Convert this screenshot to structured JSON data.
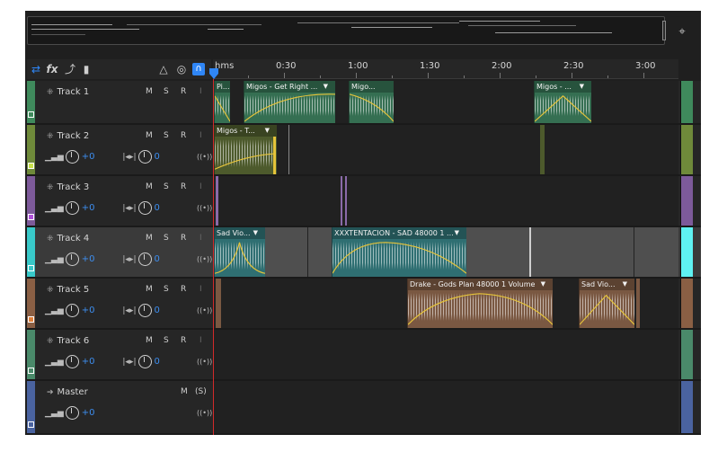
{
  "overview": {},
  "toolbar": {
    "fx_label": "fx",
    "icons": [
      "switch-icon",
      "fx-icon",
      "send-icon",
      "meter-icon",
      "metronome-icon",
      "record-monitor-icon",
      "snap-magnet-icon"
    ]
  },
  "ruler": {
    "labels": [
      "hms",
      "0:30",
      "1:00",
      "1:30",
      "2:00",
      "2:30",
      "3:00"
    ]
  },
  "colors": {
    "accent": "#2f86f6",
    "playhead": "#d22a2a",
    "envelope": "#e6c43a"
  },
  "tracks": [
    {
      "name": "Track 1",
      "m": "M",
      "s": "S",
      "r": "R",
      "i": "I",
      "color": "#3f8a5c",
      "clips": [
        {
          "title": "Pi...",
          "color": "#356f52"
        },
        {
          "title": "Migos - Get Right ...",
          "color": "#356f52"
        },
        {
          "title": "Migo...",
          "color": "#356f52"
        },
        {
          "title": "Migos - ...",
          "color": "#356f52"
        }
      ]
    },
    {
      "name": "Track 2",
      "m": "M",
      "s": "S",
      "r": "R",
      "i": "I",
      "vol": "+0",
      "pan": "0",
      "color": "#6f8a3a",
      "clips": [
        {
          "title": "Migos - T...",
          "color": "#4d5a2c"
        }
      ]
    },
    {
      "name": "Track 3",
      "m": "M",
      "s": "S",
      "r": "R",
      "i": "I",
      "vol": "+0",
      "pan": "0",
      "color": "#7d5a9a",
      "clips": []
    },
    {
      "name": "Track 4",
      "m": "M",
      "s": "S",
      "r": "R",
      "i": "I",
      "vol": "+0",
      "pan": "0",
      "color": "#38c9c9",
      "clips": [
        {
          "title": "Sad Vio...",
          "color": "#2f6f72"
        },
        {
          "title": "XXXTENTACION - SAD 48000 1 ...",
          "color": "#2f6f72"
        }
      ]
    },
    {
      "name": "Track 5",
      "m": "M",
      "s": "S",
      "r": "R",
      "i": "I",
      "vol": "+0",
      "pan": "0",
      "color": "#8a5f44",
      "clips": [
        {
          "title": "Drake - Gods Plan 48000 1   Volume",
          "color": "#7a5842"
        },
        {
          "title": "Sad Vio...",
          "color": "#7a5842"
        }
      ]
    },
    {
      "name": "Track 6",
      "m": "M",
      "s": "S",
      "r": "R",
      "i": "I",
      "vol": "+0",
      "pan": "0",
      "color": "#4a8a6a",
      "clips": []
    },
    {
      "name": "Master",
      "m": "M",
      "s": "(S)",
      "vol": "+0",
      "color": "#4a63a0",
      "clips": []
    }
  ]
}
